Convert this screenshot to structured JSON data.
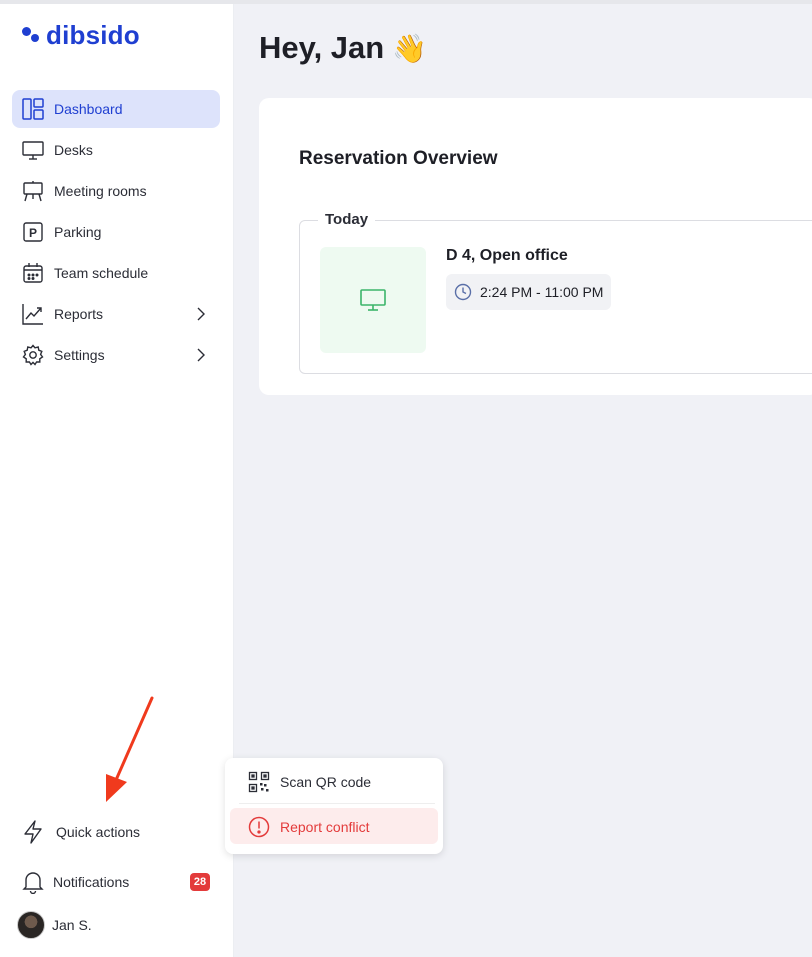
{
  "app": {
    "logo_text": "dibsido",
    "brand_color": "#1f3fd1"
  },
  "sidebar": {
    "items": [
      {
        "label": "Dashboard",
        "icon": "dashboard-icon",
        "active": true
      },
      {
        "label": "Desks",
        "icon": "monitor-icon"
      },
      {
        "label": "Meeting rooms",
        "icon": "easel-icon"
      },
      {
        "label": "Parking",
        "icon": "parking-icon"
      },
      {
        "label": "Team schedule",
        "icon": "calendar-icon"
      },
      {
        "label": "Reports",
        "icon": "chart-icon",
        "has_submenu": true
      },
      {
        "label": "Settings",
        "icon": "gear-icon",
        "has_submenu": true
      }
    ],
    "quick_actions_label": "Quick actions",
    "notifications_label": "Notifications",
    "notifications_count": "28",
    "user_name": "Jan S."
  },
  "main": {
    "greeting": "Hey, Jan",
    "greeting_emoji": "👋",
    "card": {
      "title": "Reservation Overview",
      "section_label": "Today",
      "reservation": {
        "name": "D 4, Open office",
        "time": "2:24 PM - 11:00 PM",
        "icon": "monitor-icon",
        "accent": "#3bb56a"
      }
    }
  },
  "quick_actions_menu": {
    "items": [
      {
        "label": "Scan QR code",
        "icon": "qr-code-icon"
      },
      {
        "label": "Report conflict",
        "icon": "alert-circle-icon",
        "color": "#e33b3b"
      }
    ]
  },
  "annotation": {
    "arrow_color": "#f03a1d"
  }
}
